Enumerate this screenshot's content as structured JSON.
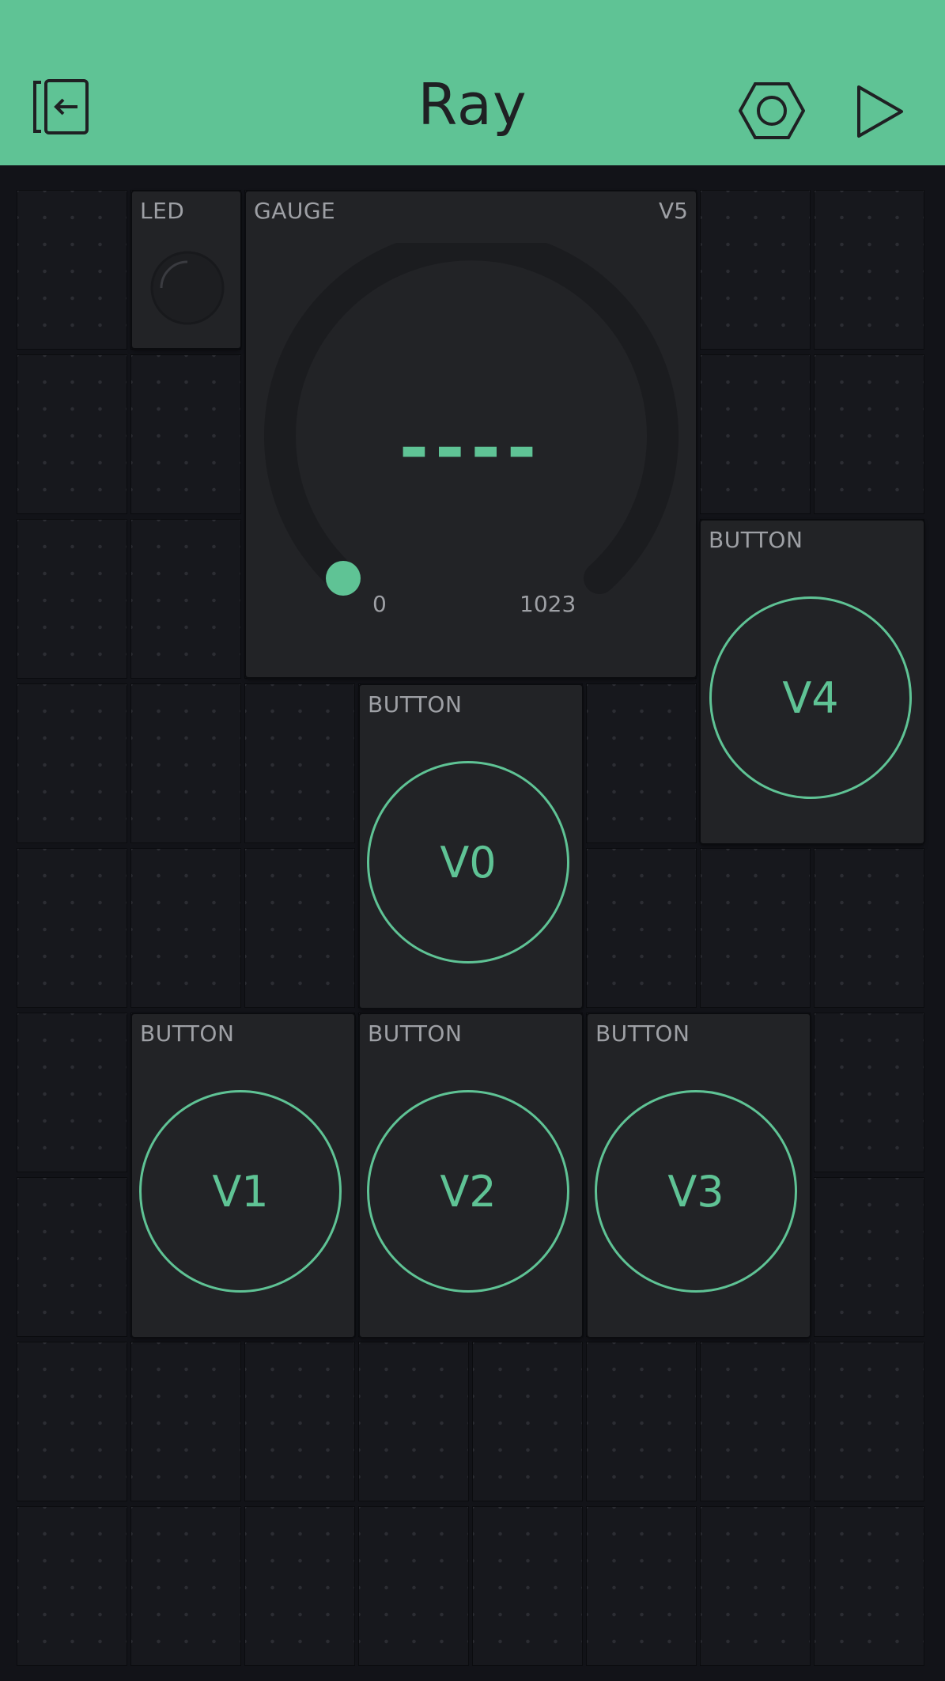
{
  "header": {
    "title": "Ray",
    "icons": [
      "exit-icon",
      "settings-hexagon-icon",
      "play-icon"
    ]
  },
  "colors": {
    "accent": "#5fc395",
    "header_bg": "#5fc395",
    "canvas_bg": "#121318",
    "widget_bg": "#222326",
    "label": "#9ea0a5"
  },
  "widgets": {
    "led": {
      "label": "LED"
    },
    "gauge": {
      "label": "GAUGE",
      "pin": "V5",
      "value": "----",
      "min": "0",
      "max": "1023",
      "level": 0
    },
    "button_v4": {
      "label": "BUTTON",
      "pin": "V4"
    },
    "button_v0": {
      "label": "BUTTON",
      "pin": "V0"
    },
    "button_v1": {
      "label": "BUTTON",
      "pin": "V1"
    },
    "button_v2": {
      "label": "BUTTON",
      "pin": "V2"
    },
    "button_v3": {
      "label": "BUTTON",
      "pin": "V3"
    }
  }
}
